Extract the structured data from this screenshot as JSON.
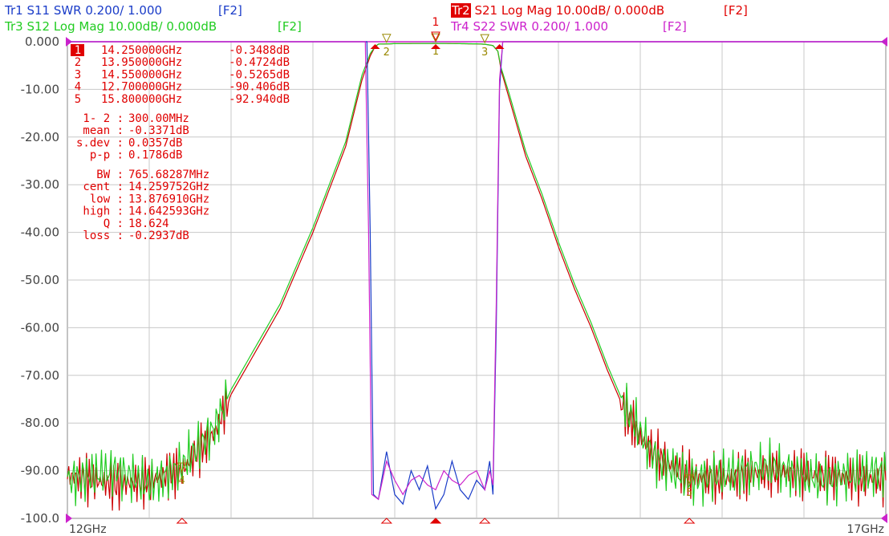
{
  "traces": [
    {
      "id": "Tr1",
      "text": "S11 SWR 0.200/ 1.000",
      "f2": "[F2]",
      "color": "#1a3cc8",
      "active": false
    },
    {
      "id": "Tr2",
      "text": "S21 Log Mag 10.00dB/ 0.000dB",
      "f2": "[F2]",
      "color": "#e00000",
      "active": true
    },
    {
      "id": "Tr3",
      "text": "S12 Log Mag 10.00dB/ 0.000dB",
      "f2": "[F2]",
      "color": "#22cc22",
      "active": false
    },
    {
      "id": "Tr4",
      "text": "S22 SWR 0.200/ 1.000",
      "f2": "[F2]",
      "color": "#cc22cc",
      "active": false
    }
  ],
  "chart_data": {
    "type": "line",
    "xlabel_left": "12GHz",
    "xlabel_right": "17GHz",
    "xlim": [
      12.0,
      17.0
    ],
    "ylim": [
      -100,
      0
    ],
    "y_ticks": [
      "0.000",
      "-10.00",
      "-20.00",
      "-30.00",
      "-40.00",
      "-50.00",
      "-60.00",
      "-70.00",
      "-80.00",
      "-90.00",
      "-100.0"
    ],
    "grid": true,
    "series": [
      {
        "name": "S21",
        "color": "#cc0000",
        "x": [
          12.0,
          12.3,
          12.5,
          12.7,
          12.8,
          12.9,
          13.0,
          13.1,
          13.2,
          13.3,
          13.4,
          13.5,
          13.6,
          13.7,
          13.75,
          13.8,
          13.85,
          13.88,
          13.9,
          13.95,
          14.0,
          14.25,
          14.5,
          14.55,
          14.6,
          14.63,
          14.65,
          14.7,
          14.75,
          14.8,
          14.9,
          15.0,
          15.1,
          15.2,
          15.3,
          15.4,
          15.5,
          15.6,
          15.8,
          16.0,
          16.3,
          16.6,
          17.0
        ],
        "y": [
          -91,
          -93,
          -92,
          -90,
          -86,
          -82,
          -74,
          -68,
          -62,
          -56,
          -48,
          -40,
          -31,
          -22,
          -15,
          -8,
          -3,
          -1,
          -0.5,
          -0.47,
          -0.4,
          -0.35,
          -0.45,
          -0.53,
          -0.8,
          -2,
          -6,
          -12,
          -18,
          -24,
          -33,
          -43,
          -52,
          -60,
          -69,
          -77,
          -83,
          -87,
          -91,
          -92,
          -90,
          -91,
          -92
        ]
      },
      {
        "name": "S12",
        "color": "#22cc22",
        "x": [
          12.0,
          12.3,
          12.5,
          12.7,
          12.8,
          12.9,
          13.0,
          13.1,
          13.2,
          13.3,
          13.4,
          13.5,
          13.6,
          13.7,
          13.75,
          13.8,
          13.85,
          13.88,
          13.9,
          13.95,
          14.0,
          14.25,
          14.5,
          14.55,
          14.6,
          14.63,
          14.65,
          14.7,
          14.75,
          14.8,
          14.9,
          15.0,
          15.1,
          15.2,
          15.3,
          15.4,
          15.5,
          15.6,
          15.8,
          16.0,
          16.3,
          16.6,
          17.0
        ],
        "y": [
          -92,
          -90,
          -93,
          -89,
          -85,
          -81,
          -73,
          -67,
          -61,
          -55,
          -47,
          -39,
          -30,
          -21,
          -14,
          -7,
          -2.5,
          -1,
          -0.5,
          -0.45,
          -0.4,
          -0.34,
          -0.44,
          -0.52,
          -0.8,
          -2,
          -5.5,
          -11,
          -17,
          -23,
          -32,
          -42,
          -51,
          -59,
          -68,
          -76,
          -82,
          -88,
          -92,
          -91,
          -89,
          -92,
          -90
        ]
      },
      {
        "name": "S11",
        "color": "#1a3cc8",
        "x": [
          12.0,
          13.83,
          13.85,
          13.87,
          13.9,
          13.95,
          14.0,
          14.05,
          14.1,
          14.15,
          14.2,
          14.25,
          14.3,
          14.35,
          14.4,
          14.45,
          14.5,
          14.55,
          14.58,
          14.6,
          14.62,
          14.64,
          14.66,
          17.0
        ],
        "y": [
          0,
          0,
          -40,
          -95,
          -96,
          -86,
          -95,
          -97,
          -90,
          -94,
          -89,
          -98,
          -95,
          -88,
          -94,
          -96,
          -92,
          -94,
          -88,
          -95,
          -60,
          -10,
          0,
          0
        ]
      },
      {
        "name": "S22",
        "color": "#cc22cc",
        "x": [
          12.0,
          13.82,
          13.84,
          13.86,
          13.9,
          13.95,
          14.0,
          14.05,
          14.1,
          14.15,
          14.2,
          14.25,
          14.3,
          14.35,
          14.4,
          14.45,
          14.5,
          14.55,
          14.58,
          14.6,
          14.62,
          14.64,
          14.66,
          17.0
        ],
        "y": [
          0,
          0,
          -40,
          -95,
          -96,
          -88,
          -92,
          -95,
          -92,
          -91,
          -93,
          -94,
          -90,
          -92,
          -93,
          -91,
          -90,
          -94,
          -90,
          -93,
          -55,
          -8,
          0,
          0
        ]
      }
    ],
    "markers": {
      "table": [
        {
          "n": "1",
          "freq": "14.250000GHz",
          "val": "-0.3488dB"
        },
        {
          "n": "2",
          "freq": "13.950000GHz",
          "val": "-0.4724dB"
        },
        {
          "n": "3",
          "freq": "14.550000GHz",
          "val": "-0.5265dB"
        },
        {
          "n": "4",
          "freq": "12.700000GHz",
          "val": "-90.406dB"
        },
        {
          "n": "5",
          "freq": "15.800000GHz",
          "val": "-92.940dB"
        }
      ],
      "stats": [
        {
          "k": "1- 2 :",
          "v": "300.00MHz"
        },
        {
          "k": "mean :",
          "v": "-0.3371dB"
        },
        {
          "k": "s.dev :",
          "v": "0.0357dB"
        },
        {
          "k": "p-p :",
          "v": "0.1786dB"
        }
      ],
      "bw": [
        {
          "k": "BW :",
          "v": "765.68287MHz"
        },
        {
          "k": "cent :",
          "v": "14.259752GHz"
        },
        {
          "k": "low :",
          "v": "13.876910GHz"
        },
        {
          "k": "high :",
          "v": "14.642593GHz"
        },
        {
          "k": "Q :",
          "v": "18.624"
        },
        {
          "k": "loss :",
          "v": "-0.2937dB"
        }
      ],
      "points": [
        {
          "n": "1",
          "x": 14.25,
          "y": -0.35
        },
        {
          "n": "2",
          "x": 13.95,
          "y": -0.47
        },
        {
          "n": "3",
          "x": 14.55,
          "y": -0.53
        },
        {
          "n": "4",
          "x": 12.7,
          "y": -90.4
        },
        {
          "n": "5",
          "x": 15.8,
          "y": -92.9
        }
      ]
    }
  }
}
